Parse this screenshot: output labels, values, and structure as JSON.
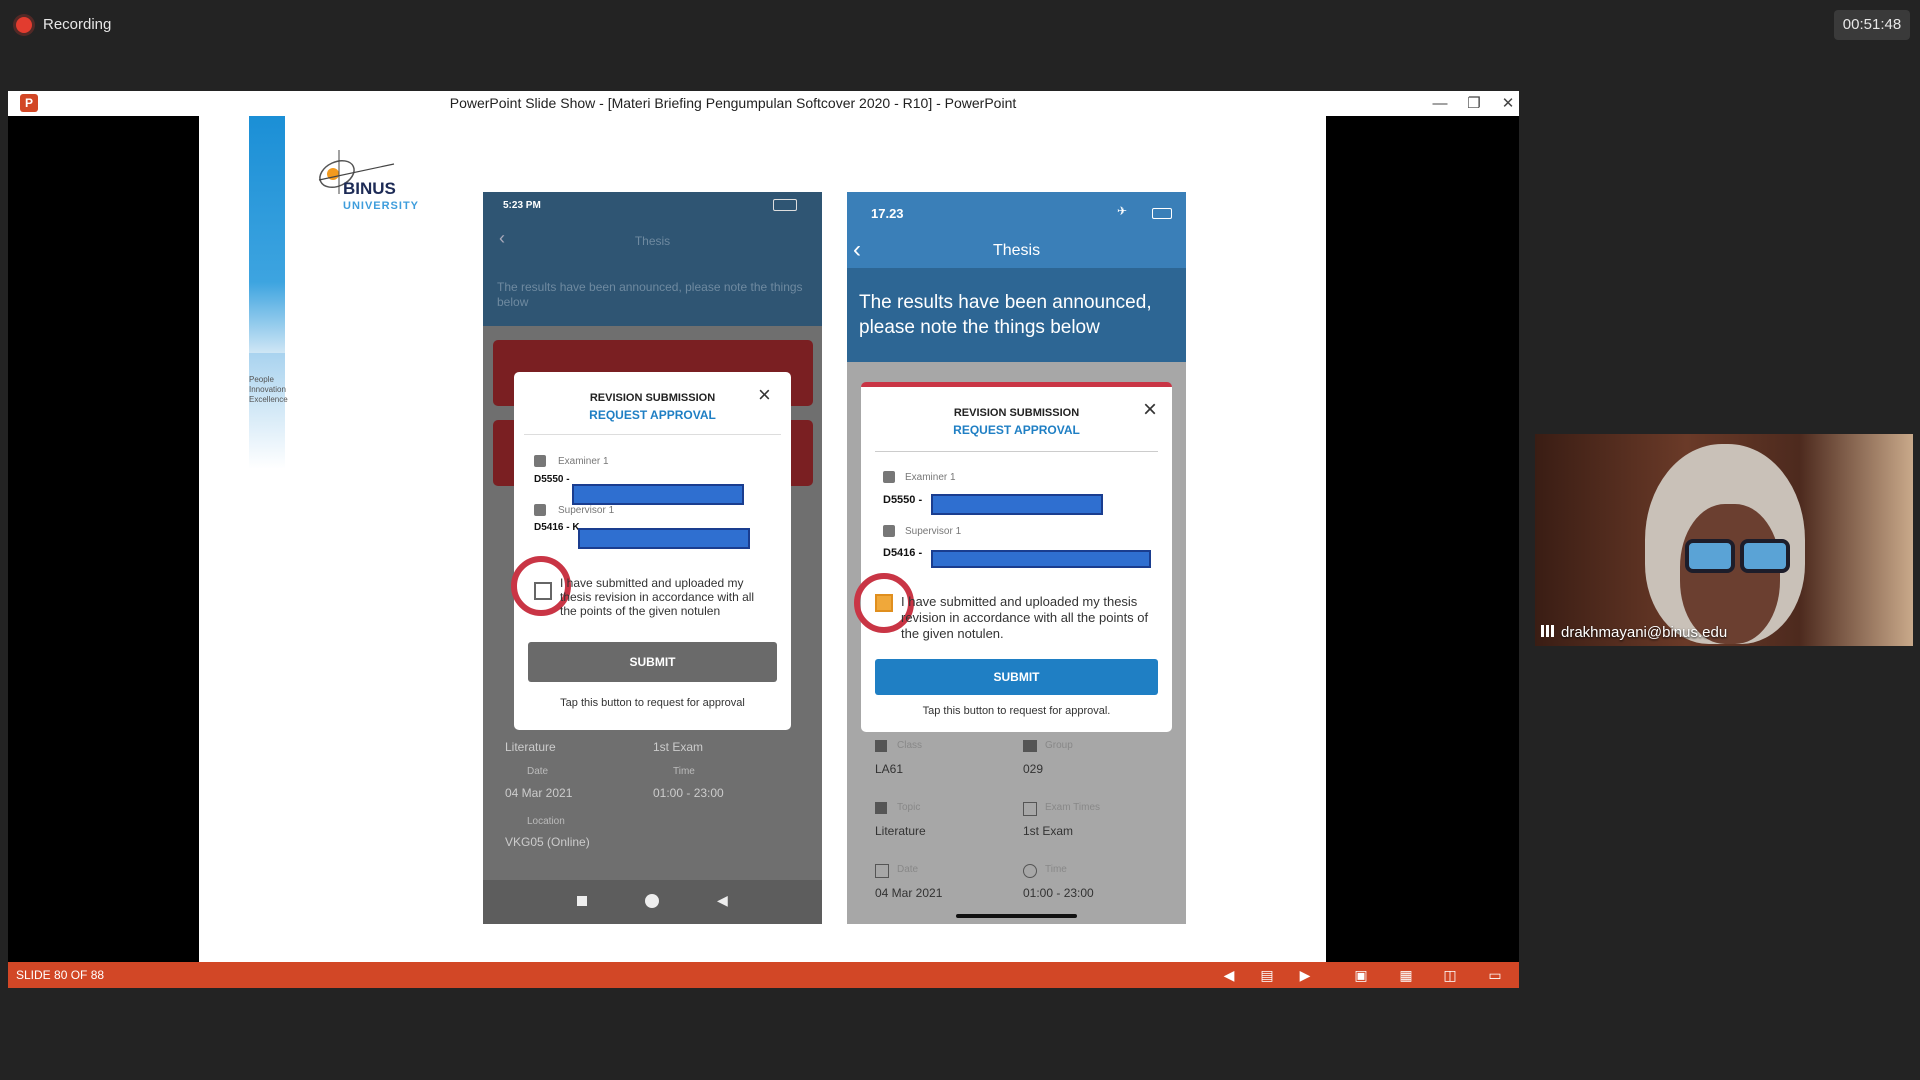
{
  "recording": {
    "label": "Recording",
    "timer": "00:51:48"
  },
  "window": {
    "title": "PowerPoint Slide Show - [Materi Briefing Pengumpulan Softcover 2020 - R10] - PowerPoint",
    "logo": "P"
  },
  "slide": {
    "logo_name": "BINUS",
    "logo_sub": "UNIVERSITY",
    "tagline": [
      "People",
      "Innovation",
      "Excellence"
    ]
  },
  "left_phone": {
    "status_time": "5:23 PM",
    "header_title": "Thesis",
    "banner": "The results have been announced, please note the things below",
    "modal": {
      "title": "REVISION SUBMISSION",
      "subtitle": "REQUEST APPROVAL",
      "examiner_label": "Examiner 1",
      "examiner_code": "D5550 -",
      "supervisor_label": "Supervisor 1",
      "supervisor_code": "D5416 - K",
      "checkbox_text": "I have submitted and uploaded my thesis revision in accordance with all the points of the given notulen",
      "submit": "SUBMIT",
      "tap_text": "Tap this button to request for approval"
    },
    "below": {
      "topic_value": "Literature",
      "exam_value": "1st Exam",
      "date_label": "Date",
      "date_value": "04 Mar 2021",
      "time_label": "Time",
      "time_value": "01:00 - 23:00",
      "location_label": "Location",
      "location_value": "VKG05 (Online)"
    }
  },
  "right_phone": {
    "status_time": "17.23",
    "header_title": "Thesis",
    "banner": "The results have been announced, please note the things below",
    "modal": {
      "title": "REVISION SUBMISSION",
      "subtitle": "REQUEST APPROVAL",
      "examiner_label": "Examiner 1",
      "examiner_code": "D5550 -",
      "supervisor_label": "Supervisor 1",
      "supervisor_code": "D5416 -",
      "checkbox_text": "I have submitted and uploaded my thesis revision in accordance with all the points of the given notulen.",
      "submit": "SUBMIT",
      "tap_text": "Tap this button to request for approval."
    },
    "below": {
      "class_label": "Class",
      "class_value": "LA61",
      "group_label": "Group",
      "group_value": "029",
      "topic_label": "Topic",
      "topic_value": "Literature",
      "exam_label": "Exam Times",
      "exam_value": "1st Exam",
      "date_label": "Date",
      "date_value": "04 Mar 2021",
      "time_label": "Time",
      "time_value": "01:00 - 23:00"
    }
  },
  "status_bar": {
    "slide_label": "SLIDE 80 OF 88",
    "accent": "#d24726"
  },
  "webcam": {
    "name": "drakhmayani@binus.edu"
  },
  "colors": {
    "accent_blue": "#1f7fc4",
    "header_blue": "#3a7fb8",
    "highlight_red": "#c93545"
  }
}
